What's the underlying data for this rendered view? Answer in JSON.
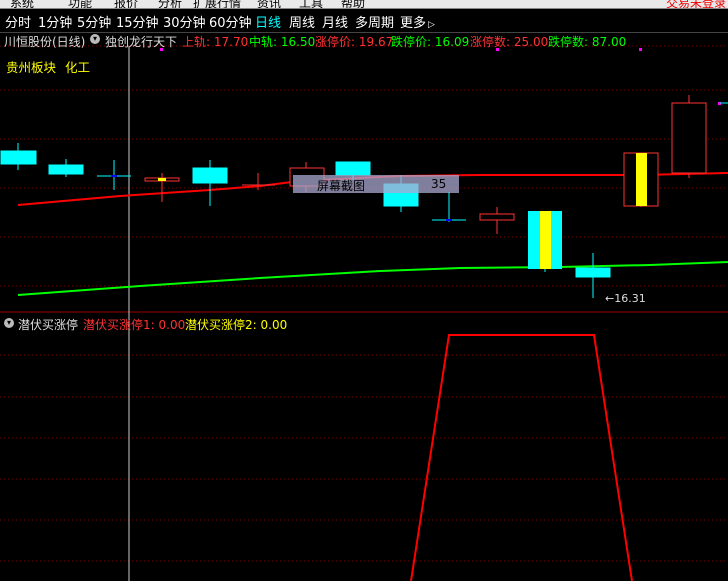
{
  "menubar": {
    "items": [
      "系统",
      "功能",
      "报价",
      "分析",
      "扩展行情",
      "资讯",
      "工具",
      "帮助"
    ],
    "right_text": "交易未登录"
  },
  "periods": {
    "items": [
      "分时",
      "1分钟",
      "5分钟",
      "15分钟",
      "30分钟",
      "60分钟",
      "日线",
      "周线",
      "月线",
      "多周期",
      "更多"
    ],
    "active": "日线",
    "more_arrow": "▷"
  },
  "chart_header": {
    "title": "川恒股份(日线)",
    "indicator_name": "独创龙行天下",
    "upper": "上轨: 17.70",
    "middle": "中轨: 16.50",
    "limit_up_price": "涨停价: 19.67",
    "limit_down_price": "跌停价: 16.09",
    "limit_up_count": "涨停数: 25.00",
    "limit_down_count": "跌停数: 87.00"
  },
  "sector": {
    "name": "贵州板块",
    "industry": "化工"
  },
  "tooltip": {
    "label": "屏幕截图",
    "value": "35"
  },
  "low_marker": "←16.31",
  "indicator_header": {
    "name": "潜伏买涨停",
    "line1": "潜伏买涨停1: 0.00",
    "line2": "潜伏买涨停2: 0.00"
  },
  "colors": {
    "up": "#ff3232",
    "down": "#00ffff",
    "middle_line": "#ff0000",
    "long_ma": "#00ff00",
    "highlight": "#ffff00",
    "indicator_line": "#ff0000"
  }
}
